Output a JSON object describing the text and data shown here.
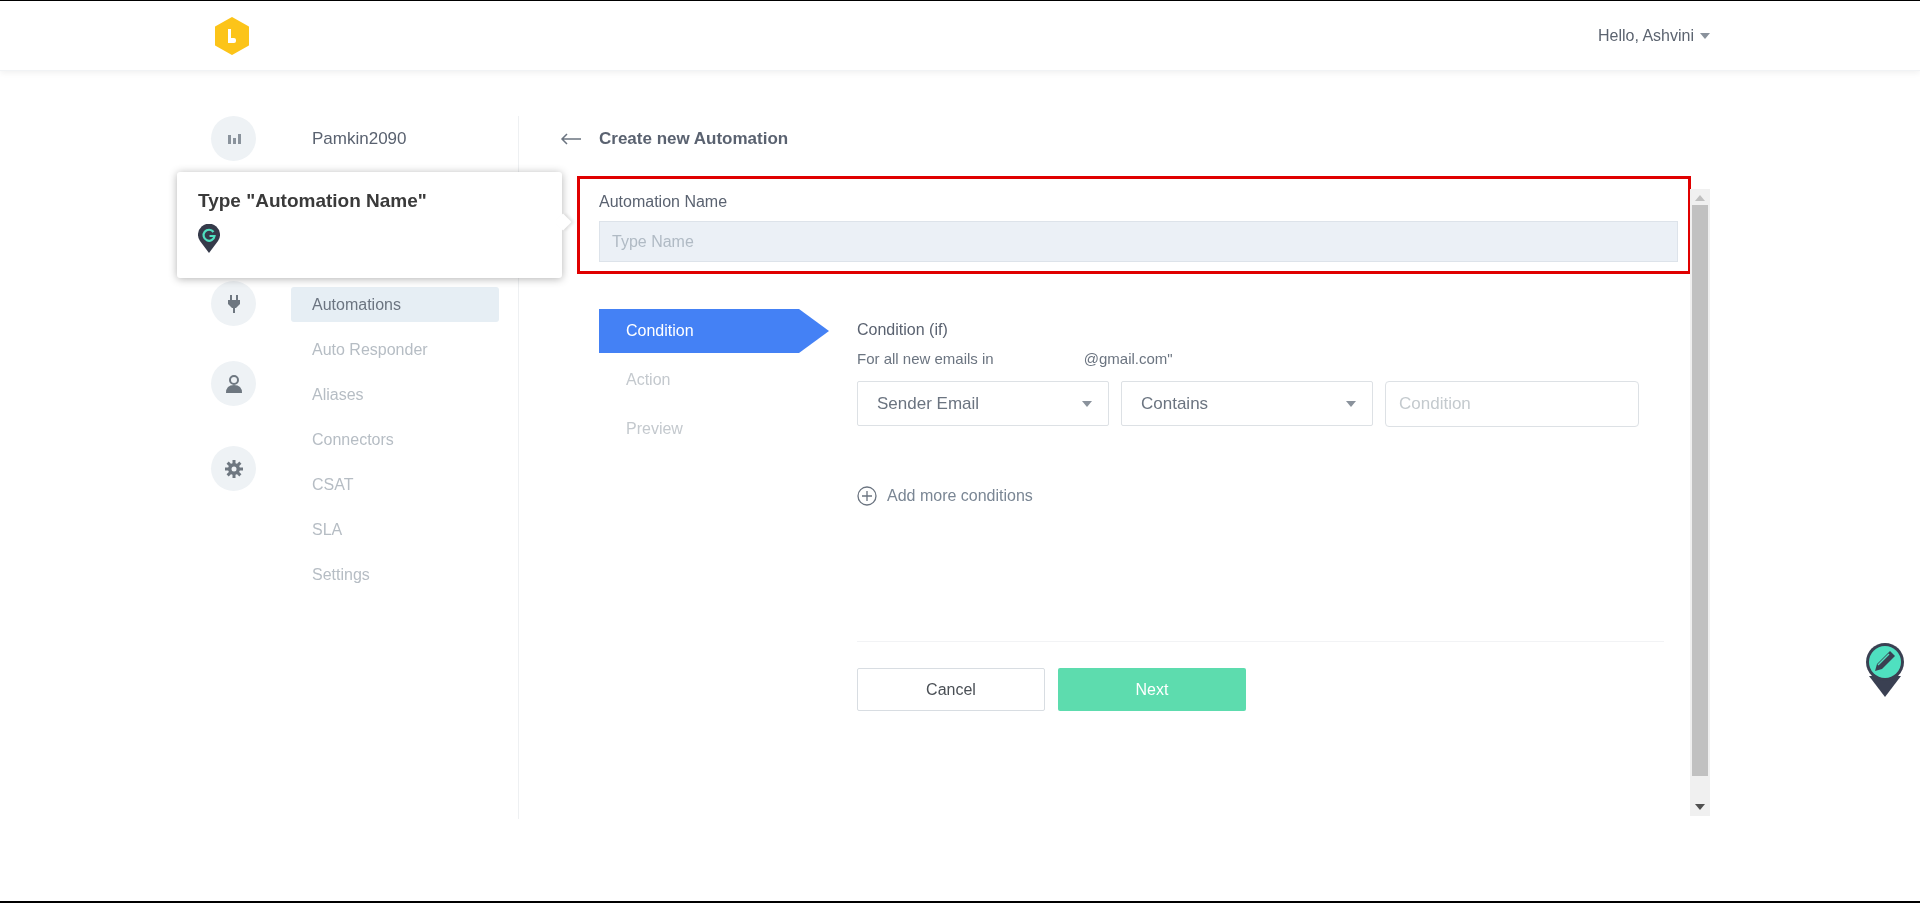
{
  "header": {
    "greeting": "Hello, Ashvini"
  },
  "sidebar": {
    "account": "Pamkin2090",
    "items": [
      {
        "label": "Automations",
        "selected": true
      },
      {
        "label": "Auto Responder",
        "selected": false
      },
      {
        "label": "Aliases",
        "selected": false
      },
      {
        "label": "Connectors",
        "selected": false
      },
      {
        "label": "CSAT",
        "selected": false
      },
      {
        "label": "SLA",
        "selected": false
      },
      {
        "label": "Settings",
        "selected": false
      }
    ]
  },
  "page_title": "Create new Automation",
  "name_field": {
    "label": "Automation Name",
    "placeholder": "Type Name"
  },
  "steps": [
    {
      "label": "Condition",
      "selected": true
    },
    {
      "label": "Action",
      "selected": false
    },
    {
      "label": "Preview",
      "selected": false
    }
  ],
  "condition": {
    "heading": "Condition (if)",
    "description": "For all new emails in",
    "email": "@gmail.com\"",
    "field": "Sender Email",
    "operator": "Contains",
    "value_placeholder": "Condition",
    "add_more": "Add more conditions"
  },
  "buttons": {
    "cancel": "Cancel",
    "next": "Next"
  },
  "tooltip": {
    "title": "Type \"Automation Name\""
  }
}
